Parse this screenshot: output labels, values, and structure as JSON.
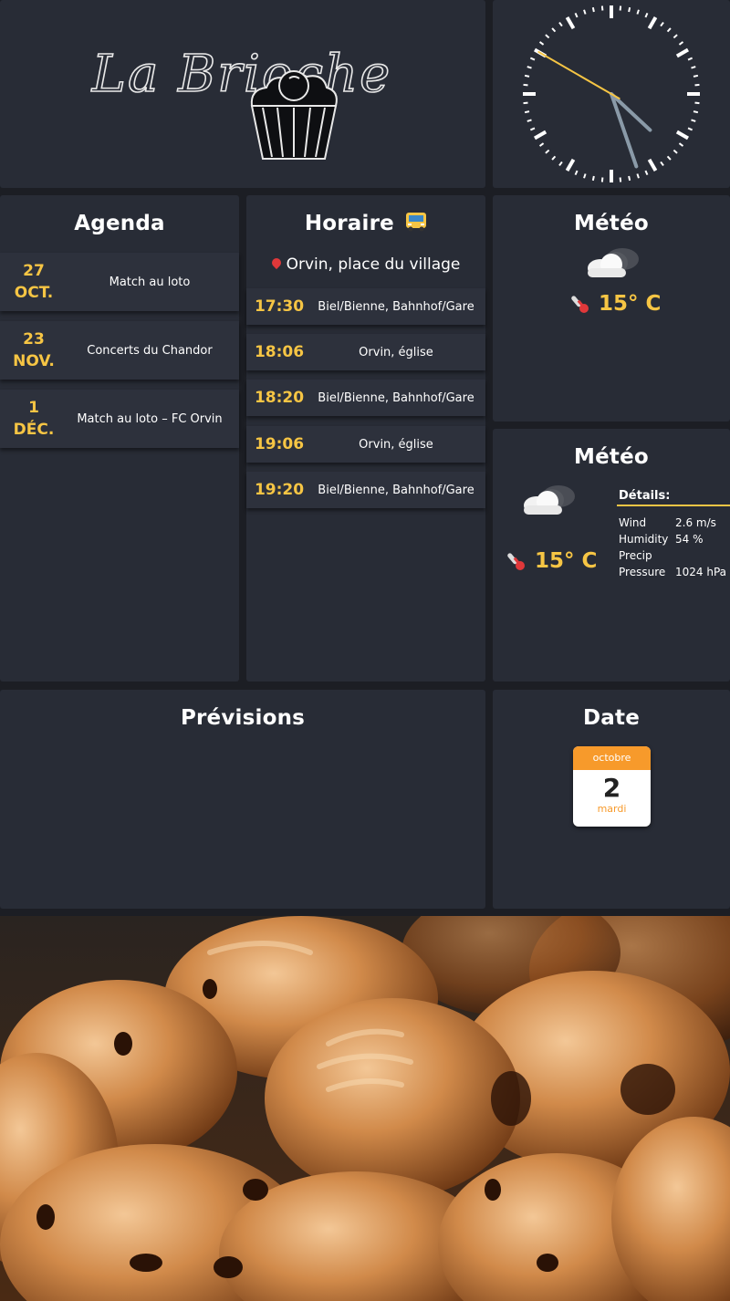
{
  "logo": {
    "text": "La Brioche"
  },
  "clock": {
    "hour": 4,
    "minute": 26,
    "second": 50
  },
  "agenda": {
    "title": "Agenda",
    "items": [
      {
        "day": "27",
        "month": "OCT.",
        "label": "Match au loto"
      },
      {
        "day": "23",
        "month": "NOV.",
        "label": "Concerts du Chandor"
      },
      {
        "day": "1",
        "month": "DÉC.",
        "label": "Match au loto – FC Orvin"
      }
    ]
  },
  "horaire": {
    "title": "Horaire",
    "title_icon": "bus-icon",
    "stop": "Orvin, place du village",
    "departures": [
      {
        "time": "17:30",
        "destination": "Biel/Bienne, Bahnhof/Gare"
      },
      {
        "time": "18:06",
        "destination": "Orvin, église"
      },
      {
        "time": "18:20",
        "destination": "Biel/Bienne, Bahnhof/Gare"
      },
      {
        "time": "19:06",
        "destination": "Orvin, église"
      },
      {
        "time": "19:20",
        "destination": "Biel/Bienne, Bahnhof/Gare"
      }
    ]
  },
  "meteo_current": {
    "title": "Météo",
    "icon": "cloudy-night-icon",
    "temperature": "15° C"
  },
  "meteo_details": {
    "title": "Météo",
    "icon": "cloudy-night-icon",
    "temperature": "15° C",
    "details_title": "Détails:",
    "rows": [
      {
        "key": "Wind",
        "value": "2.6 m/s"
      },
      {
        "key": "Humidity",
        "value": "54 %"
      },
      {
        "key": "Precip",
        "value": ""
      },
      {
        "key": "Pressure",
        "value": "1024 hPa"
      }
    ]
  },
  "previsions": {
    "title": "Prévisions"
  },
  "date": {
    "title": "Date",
    "month": "octobre",
    "day": "2",
    "weekday": "mardi"
  },
  "colors": {
    "panel": "#282c36",
    "background": "#1c1e24",
    "accent": "#f6c544",
    "calendar_header": "#f79a2b"
  }
}
